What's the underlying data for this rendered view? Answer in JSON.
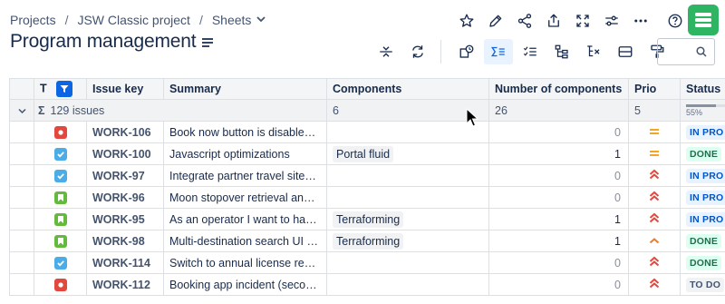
{
  "breadcrumb": {
    "projects": "Projects",
    "sep": "/",
    "project": "JSW Classic project",
    "sheets": "Sheets"
  },
  "page": {
    "title": "Program management"
  },
  "columns": {
    "type": "T",
    "key": "Issue key",
    "summary": "Summary",
    "components": "Components",
    "num_components": "Number of components",
    "prio": "Prio",
    "status": "Status"
  },
  "summary_row": {
    "sigma": "Σ",
    "issues": "129 issues",
    "components": "6",
    "num_components": "26",
    "prio": "5",
    "status_progress": "55%",
    "status_progress_value": 55
  },
  "rows": [
    {
      "type": "bug",
      "key": "WORK-106",
      "summary": "Book now button is disabled /...",
      "component": "",
      "num": "0",
      "prio": "medium",
      "status": "IN PRO"
    },
    {
      "type": "task",
      "key": "WORK-100",
      "summary": "Javascript optimizations",
      "component": "Portal fluid",
      "num": "1",
      "prio": "medium",
      "status": "DONE"
    },
    {
      "type": "task",
      "key": "WORK-97",
      "summary": "Integrate partner travel sites ...",
      "component": "",
      "num": "0",
      "prio": "highest",
      "status": "IN PRO"
    },
    {
      "type": "story",
      "key": "WORK-96",
      "summary": "Moon stopover retrieval and r...",
      "component": "",
      "num": "0",
      "prio": "highest",
      "status": "IN PRO"
    },
    {
      "type": "story",
      "key": "WORK-95",
      "summary": "As an operator I want to have...",
      "component": "Terraforming",
      "num": "1",
      "prio": "highest",
      "status": "IN PRO"
    },
    {
      "type": "story",
      "key": "WORK-98",
      "summary": "Multi-destination search UI m...",
      "component": "Terraforming",
      "num": "1",
      "prio": "high",
      "status": "DONE"
    },
    {
      "type": "task",
      "key": "WORK-114",
      "summary": "Switch to annual license rene...",
      "component": "",
      "num": "0",
      "prio": "highest",
      "status": "DONE"
    },
    {
      "type": "bug",
      "key": "WORK-112",
      "summary": "Booking app incident (secon...",
      "component": "",
      "num": "0",
      "prio": "highest",
      "status": "TO DO"
    }
  ],
  "colors": {
    "bug": "#e2483d",
    "task": "#4bade8",
    "story": "#63ba3c",
    "accent": "#0c66e4",
    "logo": "#2eb563",
    "prio_medium": "#f5a623",
    "prio_high": "#e97f33",
    "prio_highest": "#e2483d",
    "status_inprogress_bg": "#e9f2ff",
    "status_inprogress_fg": "#0055cc",
    "status_done_bg": "#dcfff1",
    "status_done_fg": "#216e4e",
    "status_todo_bg": "#f1f2f4",
    "status_todo_fg": "#44546f"
  }
}
